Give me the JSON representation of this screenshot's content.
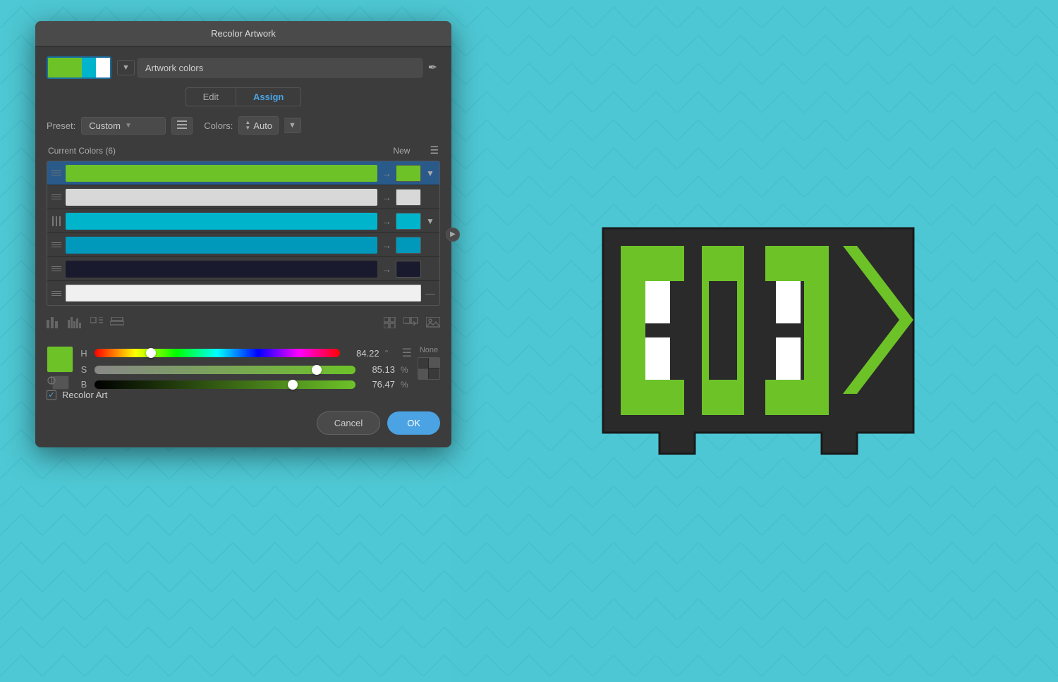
{
  "background": {
    "color": "#4ec8d4"
  },
  "dialog": {
    "title": "Recolor Artwork",
    "tabs": {
      "edit": "Edit",
      "assign": "Assign",
      "active": "assign"
    },
    "swatches": {
      "color1": "#6dc228",
      "color2": "#6dc228",
      "color3": "#00b4cc",
      "color4": "#ffffff"
    },
    "artwork_colors_label": "Artwork colors",
    "preset": {
      "label": "Preset:",
      "value": "Custom"
    },
    "colors": {
      "label": "Colors:",
      "value": "Auto"
    },
    "color_rows": {
      "title": "Current Colors (6)",
      "new_label": "New",
      "rows": [
        {
          "current": "#6dc228",
          "new": "#6dc228",
          "selected": true,
          "has_expand": true,
          "show_dash": false
        },
        {
          "current": "#e0e0e0",
          "new": "#e0e0e0",
          "selected": false,
          "has_expand": false,
          "show_dash": false
        },
        {
          "current": "#00b4cc",
          "new": "#00b4cc",
          "selected": false,
          "has_expand": true,
          "show_dash": false
        },
        {
          "current": "#0099bb",
          "new": "#0099bb",
          "selected": false,
          "has_expand": false,
          "show_dash": false
        },
        {
          "current": "#1a1a2e",
          "new": "#1a1a2e",
          "selected": false,
          "has_expand": false,
          "show_dash": false
        },
        {
          "current": "#ffffff",
          "new": "#ffffff",
          "selected": false,
          "has_expand": false,
          "show_dash": true
        }
      ]
    },
    "color_picker": {
      "preview_color": "#6dc228",
      "h_label": "H",
      "h_value": "84.22",
      "h_unit": "°",
      "h_pct": 23,
      "s_label": "S",
      "s_value": "85.13",
      "s_unit": "%",
      "s_pct": 85,
      "b_label": "B",
      "b_value": "76.47",
      "b_unit": "%",
      "b_pct": 76,
      "none_label": "None"
    },
    "recolor_art": {
      "label": "Recolor Art",
      "checked": true
    },
    "buttons": {
      "cancel": "Cancel",
      "ok": "OK"
    }
  }
}
